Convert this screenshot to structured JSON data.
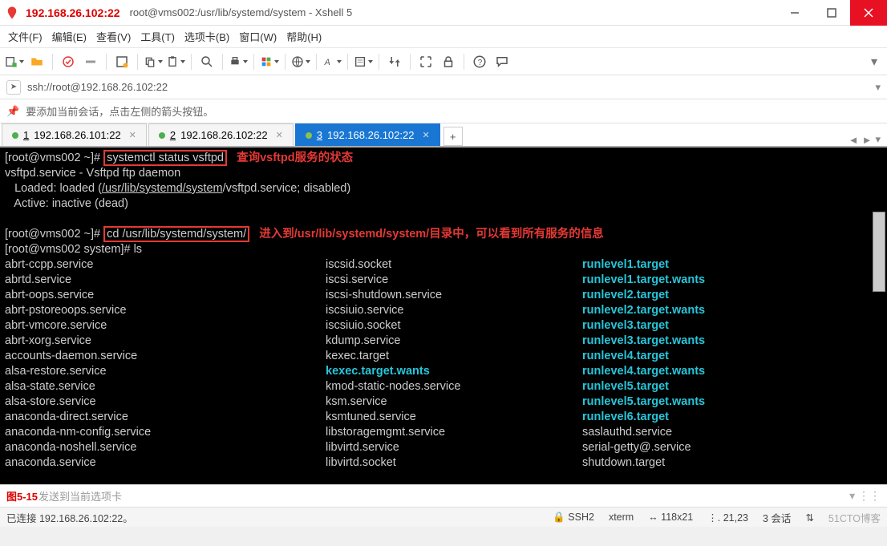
{
  "title": {
    "ip": "192.168.26.102:22",
    "rest": "root@vms002:/usr/lib/systemd/system - Xshell 5"
  },
  "menu": [
    "文件(F)",
    "编辑(E)",
    "查看(V)",
    "工具(T)",
    "选项卡(B)",
    "窗口(W)",
    "帮助(H)"
  ],
  "addressbar": {
    "url": "ssh://root@192.168.26.102:22"
  },
  "hint": "要添加当前会话，点击左侧的箭头按钮。",
  "tabs": [
    {
      "num": "1",
      "label": "192.168.26.101:22",
      "active": false
    },
    {
      "num": "2",
      "label": "192.168.26.102:22",
      "active": false
    },
    {
      "num": "3",
      "label": "192.168.26.102:22",
      "active": true
    }
  ],
  "term": {
    "prompt1": "[root@vms002 ~]# ",
    "cmd1": "systemctl status vsftpd",
    "anno1": "   查询vsftpd服务的状态",
    "l2": "vsftpd.service - Vsftpd ftp daemon",
    "l3a": "   Loaded: loaded (",
    "l3b": "/usr/lib/systemd/system",
    "l3c": "/vsftpd.service; disabled)",
    "l4": "   Active: inactive (dead)",
    "prompt2": "[root@vms002 ~]# ",
    "cmd2": "cd /usr/lib/systemd/system/",
    "anno2": "   进入到/usr/lib/systemd/system/目录中，可以看到所有服务的信息",
    "l7": "[root@vms002 system]# ls",
    "cols": [
      [
        "abrt-ccpp.service",
        "iscsid.socket",
        "runlevel1.target",
        "cyan"
      ],
      [
        "abrtd.service",
        "iscsi.service",
        "runlevel1.target.wants",
        "cyan"
      ],
      [
        "abrt-oops.service",
        "iscsi-shutdown.service",
        "runlevel2.target",
        "cyan"
      ],
      [
        "abrt-pstoreoops.service",
        "iscsiuio.service",
        "runlevel2.target.wants",
        "cyan"
      ],
      [
        "abrt-vmcore.service",
        "iscsiuio.socket",
        "runlevel3.target",
        "cyan"
      ],
      [
        "abrt-xorg.service",
        "kdump.service",
        "runlevel3.target.wants",
        "cyan"
      ],
      [
        "accounts-daemon.service",
        "kexec.target",
        "runlevel4.target",
        "cyan"
      ],
      [
        "alsa-restore.service",
        "kexec.target.wants",
        "runlevel4.target.wants",
        "cyan2"
      ],
      [
        "alsa-state.service",
        "kmod-static-nodes.service",
        "runlevel5.target",
        "cyan"
      ],
      [
        "alsa-store.service",
        "ksm.service",
        "runlevel5.target.wants",
        "cyan"
      ],
      [
        "anaconda-direct.service",
        "ksmtuned.service",
        "runlevel6.target",
        "cyan"
      ],
      [
        "anaconda-nm-config.service",
        "libstoragemgmt.service",
        "saslauthd.service",
        "plain"
      ],
      [
        "anaconda-noshell.service",
        "libvirtd.service",
        "serial-getty@.service",
        "plain"
      ],
      [
        "anaconda.service",
        "libvirtd.socket",
        "shutdown.target",
        "plain"
      ]
    ]
  },
  "inputbar": {
    "fig": "图5-15",
    "hint": "发送到当前选项卡"
  },
  "status": {
    "conn": "已连接 192.168.26.102:22。",
    "ssh": "SSH2",
    "term": "xterm",
    "size": "118x21",
    "pos": "21,23",
    "sess": "3 会话",
    "wm": "51CTO博客"
  },
  "icons": {
    "lock": "🔒",
    "ssh": "🖧",
    "size": "↔",
    "pos": "⌖",
    "sess": "⧉"
  }
}
